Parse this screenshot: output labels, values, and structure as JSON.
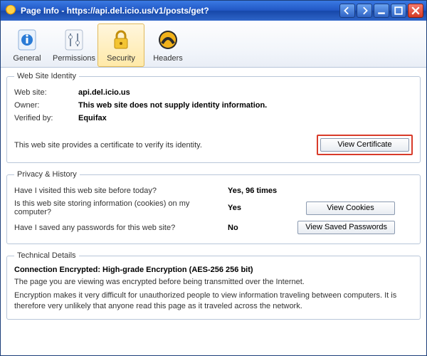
{
  "window": {
    "title": "Page Info - https://api.del.icio.us/v1/posts/get?"
  },
  "toolbar": {
    "general": "General",
    "permissions": "Permissions",
    "security": "Security",
    "headers": "Headers",
    "selected": "security"
  },
  "identity": {
    "legend": "Web Site Identity",
    "website_label": "Web site:",
    "website_value": "api.del.icio.us",
    "owner_label": "Owner:",
    "owner_value": "This web site does not supply identity information.",
    "verified_label": "Verified by:",
    "verified_value": "Equifax",
    "cert_text": "This web site provides a certificate to verify its identity.",
    "view_cert_btn": "View Certificate"
  },
  "privacy": {
    "legend": "Privacy & History",
    "q_visited": "Have I visited this web site before today?",
    "a_visited": "Yes, 96 times",
    "q_cookies": "Is this web site storing information (cookies) on my computer?",
    "a_cookies": "Yes",
    "btn_cookies": "View Cookies",
    "q_passwords": "Have I saved any passwords for this web site?",
    "a_passwords": "No",
    "btn_passwords": "View Saved Passwords"
  },
  "technical": {
    "legend": "Technical Details",
    "title": "Connection Encrypted: High-grade Encryption (AES-256 256 bit)",
    "line1": "The page you are viewing was encrypted before being transmitted over the Internet.",
    "line2": "Encryption makes it very difficult for unauthorized people to view information traveling between computers. It is therefore very unlikely that anyone read this page as it traveled across the network."
  }
}
